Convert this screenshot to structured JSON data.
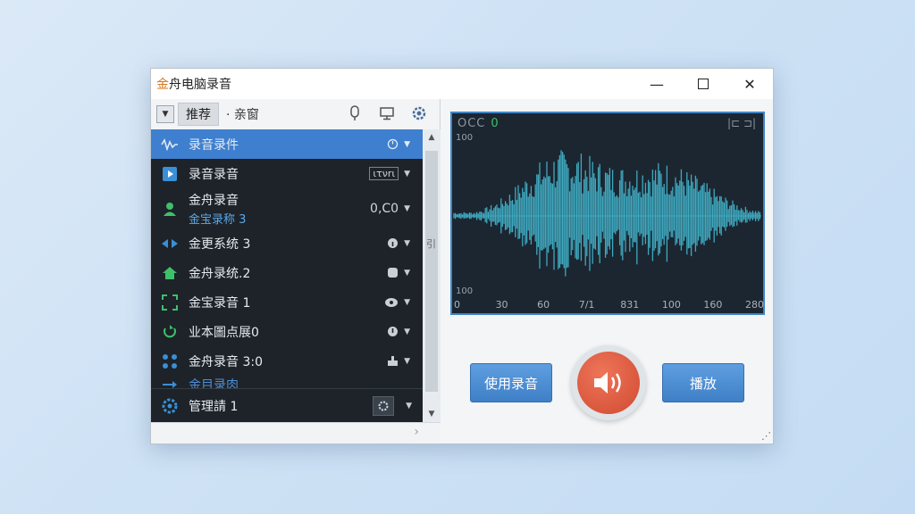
{
  "window": {
    "title_accent": "金",
    "title_rest": "舟电脑录音",
    "minimize": "—",
    "close": "✕"
  },
  "toolbar": {
    "tab_active": "推荐",
    "tab_other": "· 亲窗"
  },
  "list": {
    "items": [
      {
        "label": "录音录件",
        "icon": "waveform-icon",
        "right": "",
        "selected": true
      },
      {
        "label": "录音录音",
        "icon": "play-icon",
        "right": "ιτνrι"
      },
      {
        "label": "金舟录音",
        "sub": "金宝录称 3",
        "icon": "user-icon",
        "right": "0,C0"
      },
      {
        "label": "金更系统 3",
        "icon": "code-arrows-icon",
        "right": ""
      },
      {
        "label": "金舟录统.2",
        "icon": "home-icon",
        "right": ""
      },
      {
        "label": "金宝录音 1",
        "icon": "frame-icon",
        "right": ""
      },
      {
        "label": "业本圖点展0",
        "icon": "rotate-icon",
        "right": ""
      },
      {
        "label": "金舟录音 3:0",
        "icon": "grid-dots-icon",
        "right": ""
      },
      {
        "label": "金目录肉",
        "icon": "arrow-right-icon",
        "right": ""
      }
    ],
    "settings_label": "管理請 1"
  },
  "scrollbar": {
    "up": "▲",
    "down": "▼",
    "mark": "引"
  },
  "waveform": {
    "header": "OCC",
    "header_value": "0",
    "top_right": "|⊏ ⊐|",
    "y_top": "100",
    "y_bottom": "100",
    "x_ticks": [
      "0",
      "30",
      "60",
      "7/1",
      "831",
      "100",
      "160",
      "280"
    ]
  },
  "buttons": {
    "left": "使用录音",
    "right": "播放"
  },
  "colors": {
    "accent": "#3f7fcf",
    "wave": "#3fa9bf",
    "record": "#d04a31"
  }
}
